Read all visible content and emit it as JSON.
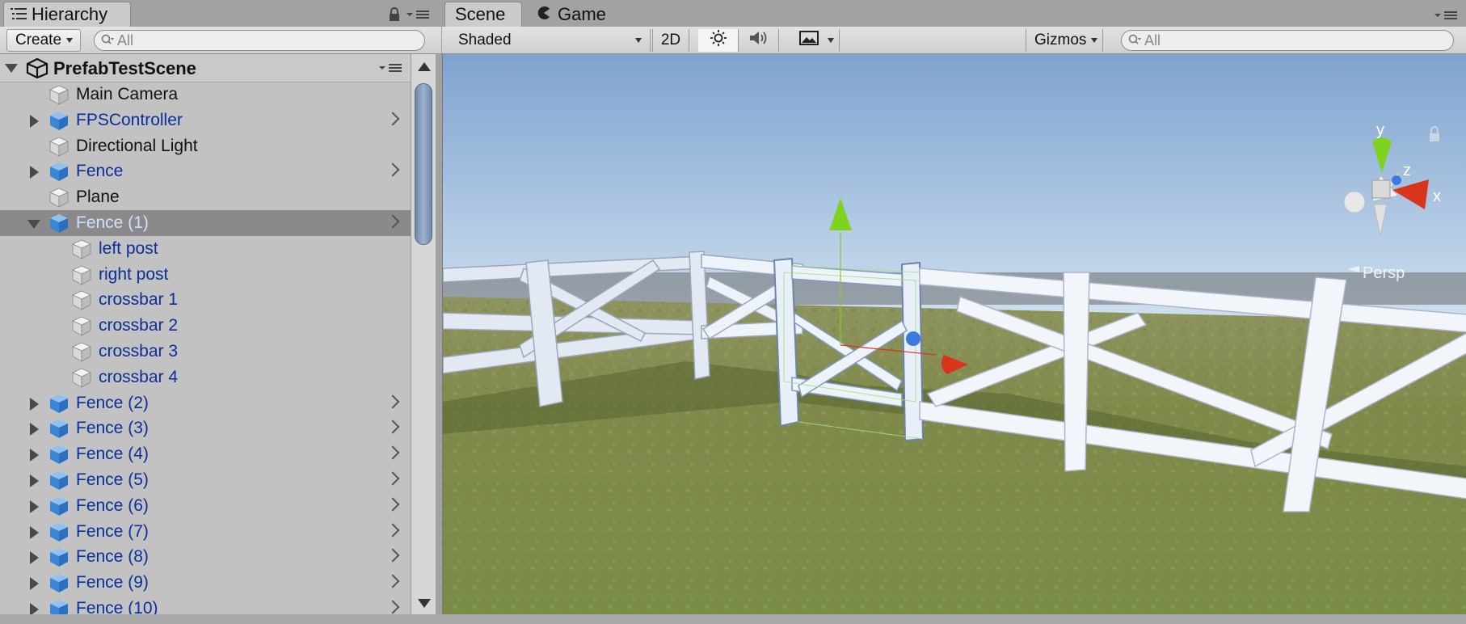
{
  "hierarchy_tab": {
    "label": "Hierarchy"
  },
  "hierarchy_toolbar": {
    "create_label": "Create",
    "search_placeholder": "All"
  },
  "scene_name": "PrefabTestScene",
  "hierarchy_items": [
    {
      "label": "Main Camera",
      "color": "#111111",
      "indent": 1,
      "arrow": "none",
      "chevron": false,
      "icon": "cube-white-icon"
    },
    {
      "label": "FPSController",
      "color": "#0b2f9a",
      "indent": 1,
      "arrow": "right",
      "chevron": true,
      "icon": "cube-blue-icon"
    },
    {
      "label": "Directional Light",
      "color": "#111111",
      "indent": 1,
      "arrow": "none",
      "chevron": false,
      "icon": "cube-white-icon"
    },
    {
      "label": "Fence",
      "color": "#0b2f9a",
      "indent": 1,
      "arrow": "right",
      "chevron": true,
      "icon": "cube-blue-icon"
    },
    {
      "label": "Plane",
      "color": "#111111",
      "indent": 1,
      "arrow": "none",
      "chevron": false,
      "icon": "cube-white-icon"
    },
    {
      "label": "Fence (1)",
      "color": "#cfe0ff",
      "indent": 1,
      "arrow": "down",
      "chevron": true,
      "icon": "cube-blue-icon",
      "selected": true
    },
    {
      "label": "left post",
      "color": "#0b2f9a",
      "indent": 2,
      "arrow": "none",
      "chevron": false,
      "icon": "cube-white-icon"
    },
    {
      "label": "right post",
      "color": "#0b2f9a",
      "indent": 2,
      "arrow": "none",
      "chevron": false,
      "icon": "cube-white-icon"
    },
    {
      "label": "crossbar 1",
      "color": "#0b2f9a",
      "indent": 2,
      "arrow": "none",
      "chevron": false,
      "icon": "cube-white-icon"
    },
    {
      "label": "crossbar 2",
      "color": "#0b2f9a",
      "indent": 2,
      "arrow": "none",
      "chevron": false,
      "icon": "cube-white-icon"
    },
    {
      "label": "crossbar 3",
      "color": "#0b2f9a",
      "indent": 2,
      "arrow": "none",
      "chevron": false,
      "icon": "cube-white-icon"
    },
    {
      "label": "crossbar 4",
      "color": "#0b2f9a",
      "indent": 2,
      "arrow": "none",
      "chevron": false,
      "icon": "cube-white-icon"
    },
    {
      "label": "Fence (2)",
      "color": "#0b2f9a",
      "indent": 1,
      "arrow": "right",
      "chevron": true,
      "icon": "cube-blue-icon"
    },
    {
      "label": "Fence (3)",
      "color": "#0b2f9a",
      "indent": 1,
      "arrow": "right",
      "chevron": true,
      "icon": "cube-blue-icon"
    },
    {
      "label": "Fence (4)",
      "color": "#0b2f9a",
      "indent": 1,
      "arrow": "right",
      "chevron": true,
      "icon": "cube-blue-icon"
    },
    {
      "label": "Fence (5)",
      "color": "#0b2f9a",
      "indent": 1,
      "arrow": "right",
      "chevron": true,
      "icon": "cube-blue-icon"
    },
    {
      "label": "Fence (6)",
      "color": "#0b2f9a",
      "indent": 1,
      "arrow": "right",
      "chevron": true,
      "icon": "cube-blue-icon"
    },
    {
      "label": "Fence (7)",
      "color": "#0b2f9a",
      "indent": 1,
      "arrow": "right",
      "chevron": true,
      "icon": "cube-blue-icon"
    },
    {
      "label": "Fence (8)",
      "color": "#0b2f9a",
      "indent": 1,
      "arrow": "right",
      "chevron": true,
      "icon": "cube-blue-icon"
    },
    {
      "label": "Fence (9)",
      "color": "#0b2f9a",
      "indent": 1,
      "arrow": "right",
      "chevron": true,
      "icon": "cube-blue-icon"
    },
    {
      "label": "Fence (10)",
      "color": "#0b2f9a",
      "indent": 1,
      "arrow": "right",
      "chevron": true,
      "icon": "cube-blue-icon"
    }
  ],
  "scene_tabs": {
    "scene_label": "Scene",
    "game_label": "Game"
  },
  "scene_toolbar": {
    "shading_mode": "Shaded",
    "mode_2d_label": "2D",
    "gizmos_label": "Gizmos",
    "search_placeholder": "All"
  },
  "orientation_gizmo": {
    "y_label": "y",
    "z_label": "z",
    "x_label": "x",
    "projection_label": "Persp"
  },
  "colors": {
    "selection_row": "#8a8a8a",
    "prefab_text": "#0b2f9a",
    "axis_x": "#d9341c",
    "axis_y": "#7ed321",
    "axis_z": "#3b7be0"
  }
}
